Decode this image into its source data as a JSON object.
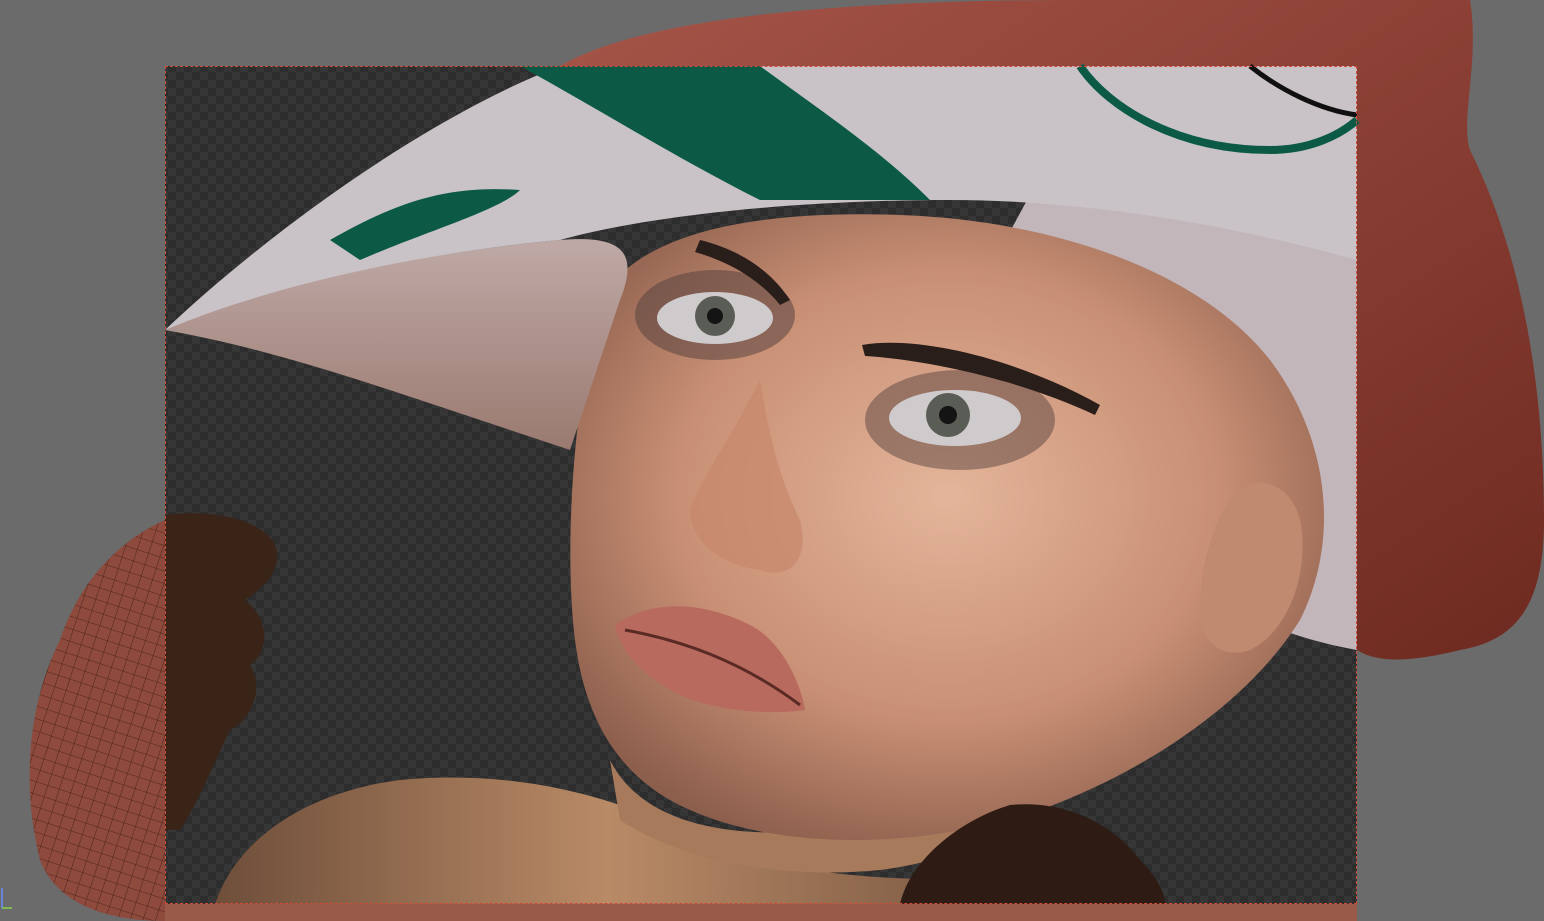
{
  "viewport": {
    "mode": "render-preview",
    "background_color": "#6b6b6b",
    "checker_dark": "#2d2d2d",
    "checker_light": "#363636",
    "frame_border_color": "#d04a3a"
  },
  "scene": {
    "skin_color": "#d9a78d",
    "hat_fabric_color": "#c9c3c8",
    "hat_pattern_color": "#0c5a45",
    "hat_outer_mesh_color": "#9a4a3f",
    "hand_mesh_color": "#8e4a3c",
    "lip_color": "#b86a5f",
    "eye_color": "#5a5d55"
  }
}
